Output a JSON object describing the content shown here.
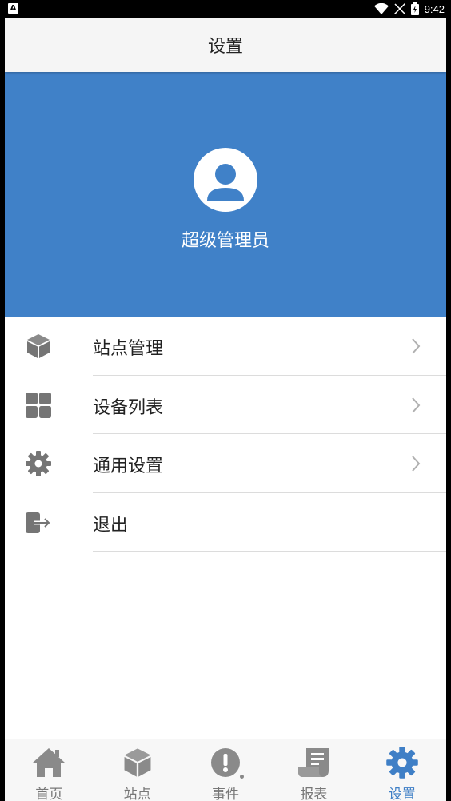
{
  "status": {
    "left_badge": "A",
    "time": "9:42"
  },
  "header": {
    "title": "设置"
  },
  "profile": {
    "username": "超级管理员"
  },
  "menu": {
    "items": [
      {
        "label": "站点管理",
        "icon": "cube-icon",
        "has_chevron": true
      },
      {
        "label": "设备列表",
        "icon": "grid-icon",
        "has_chevron": true
      },
      {
        "label": "通用设置",
        "icon": "gear-icon",
        "has_chevron": true
      },
      {
        "label": "退出",
        "icon": "logout-icon",
        "has_chevron": false
      }
    ]
  },
  "tabbar": {
    "items": [
      {
        "label": "首页",
        "icon": "home-icon"
      },
      {
        "label": "站点",
        "icon": "cube-icon"
      },
      {
        "label": "事件",
        "icon": "alert-icon"
      },
      {
        "label": "报表",
        "icon": "report-icon"
      },
      {
        "label": "设置",
        "icon": "gear-icon"
      }
    ],
    "active_index": 4
  },
  "colors": {
    "accent": "#4081c8",
    "active_tab": "#3f7fc6",
    "icon_gray": "#757575",
    "tab_icon_gray": "#8a8a8a"
  }
}
